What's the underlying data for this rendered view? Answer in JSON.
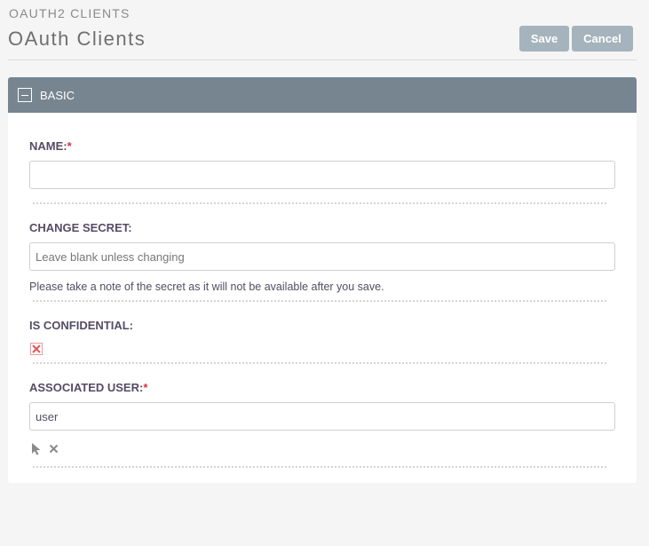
{
  "header": {
    "module_name": "OAUTH2 CLIENTS",
    "page_title": "OAuth Clients",
    "save_label": "Save",
    "cancel_label": "Cancel"
  },
  "panel": {
    "title": "BASIC",
    "fields": {
      "name": {
        "label": "NAME:",
        "required": "*",
        "value": ""
      },
      "change_secret": {
        "label": "CHANGE SECRET:",
        "placeholder": "Leave blank unless changing",
        "help": "Please take a note of the secret as it will not be available after you save."
      },
      "is_confidential": {
        "label": "IS CONFIDENTIAL:",
        "checked": false
      },
      "associated_user": {
        "label": "ASSOCIATED USER:",
        "required": "*",
        "value": "user"
      }
    }
  },
  "colors": {
    "header_bar": "#778591",
    "button": "#a5b3bd",
    "required": "#d8343d"
  },
  "icons": [
    "collapse-icon",
    "unchecked-x-icon",
    "select-cursor-icon",
    "clear-x-icon"
  ]
}
